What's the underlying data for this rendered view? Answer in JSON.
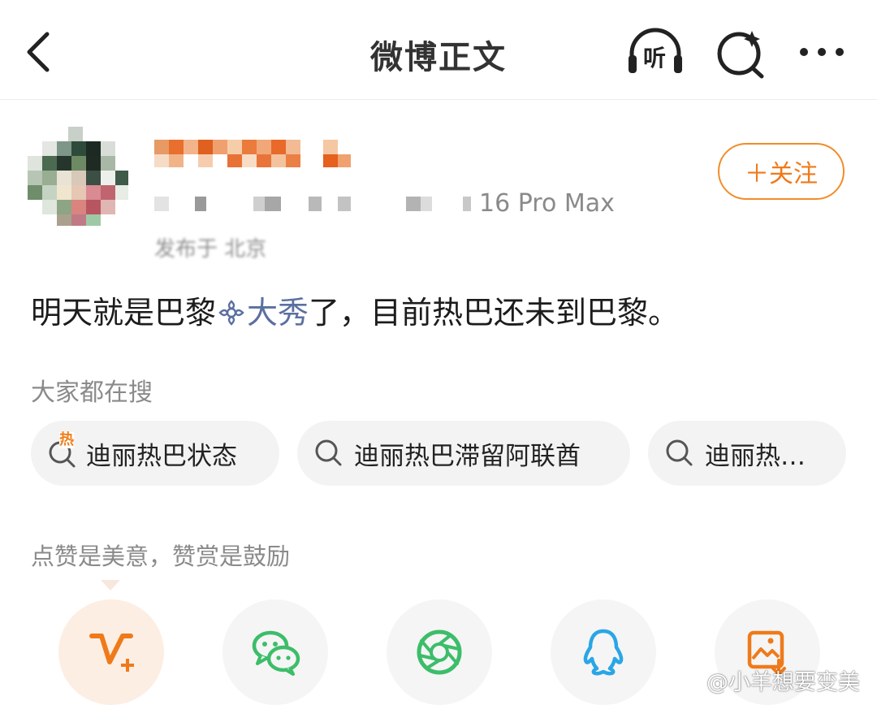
{
  "header": {
    "title": "微博正文",
    "listen_label": "听"
  },
  "user": {
    "device_suffix": "16 Pro Max",
    "ip_location": "发布于 北京",
    "follow_label": "＋关注"
  },
  "post": {
    "text_before": "明天就是巴黎",
    "topic": "大秀",
    "text_after": "了，目前热巴还未到巴黎。"
  },
  "search": {
    "label": "大家都在搜",
    "hot_badge": "热",
    "chips": [
      "迪丽热巴状态",
      "迪丽热巴滞留阿联酋",
      "迪丽热…"
    ]
  },
  "reward": {
    "label": "点赞是美意，赞赏是鼓励"
  },
  "share": {
    "items": [
      "v-plus-icon",
      "wechat-icon",
      "moments-icon",
      "qq-icon",
      "save-image-icon"
    ]
  },
  "colors": {
    "accent": "#ef7a1a",
    "topic": "#5b6fa0",
    "wechat": "#3dbd6a",
    "qq": "#2aa6e6"
  },
  "watermark": {
    "text": "@小羊想要变美"
  }
}
